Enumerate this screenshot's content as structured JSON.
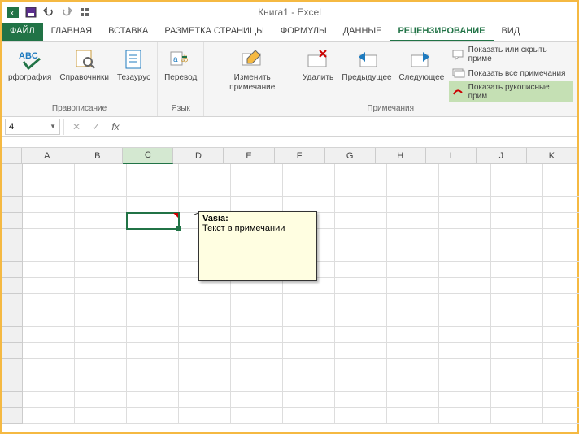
{
  "window": {
    "title": "Книга1 - Excel"
  },
  "tabs": {
    "file": "ФАЙЛ",
    "home": "ГЛАВНАЯ",
    "insert": "ВСТАВКА",
    "page_layout": "РАЗМЕТКА СТРАНИЦЫ",
    "formulas": "ФОРМУЛЫ",
    "data": "ДАННЫЕ",
    "review": "РЕЦЕНЗИРОВАНИЕ",
    "view": "ВИД"
  },
  "ribbon": {
    "proofing": {
      "label": "Правописание",
      "spelling": "рфография",
      "research": "Справочники",
      "thesaurus": "Тезаурус"
    },
    "language": {
      "label": "Язык",
      "translate": "Перевод"
    },
    "comments": {
      "label": "Примечания",
      "edit": "Изменить примечание",
      "delete": "Удалить",
      "previous": "Предыдущее",
      "next": "Следующее",
      "show_hide": "Показать или скрыть приме",
      "show_all": "Показать все примечания",
      "show_ink": "Показать рукописные прим"
    }
  },
  "namebox": "4",
  "columns": [
    "A",
    "B",
    "C",
    "D",
    "E",
    "F",
    "G",
    "H",
    "I",
    "J",
    "K"
  ],
  "selected_col": "C",
  "comment": {
    "author": "Vasia:",
    "text": "Текст в примечании"
  }
}
